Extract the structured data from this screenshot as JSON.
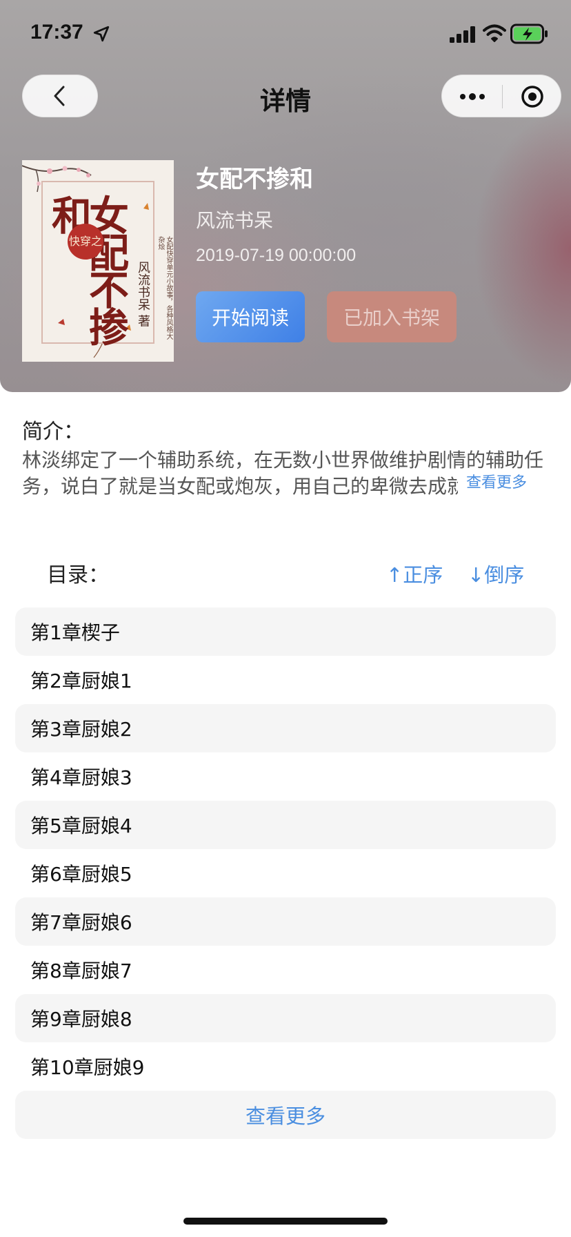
{
  "status_bar": {
    "time": "17:37"
  },
  "nav": {
    "title": "详情"
  },
  "book": {
    "title": "女配不掺和",
    "author": "风流书呆",
    "date": "2019-07-19 00:00:00",
    "cover": {
      "title": "女配不掺和",
      "seal": "快穿之",
      "author": "风流书呆 著",
      "blurb": "女配快穿单元小故事，各种风格大杂烩"
    }
  },
  "actions": {
    "read_label": "开始阅读",
    "shelf_label": "已加入书架"
  },
  "intro": {
    "label": "简介：",
    "text": "林淡绑定了一个辅助系统，在无数小世界做维护剧情的辅助任务，说白了就是当女配或炮灰，用自己的卑微去成就",
    "more_label": "查看更多"
  },
  "toc": {
    "label": "目录：",
    "sort_asc_label": "↑正序",
    "sort_desc_label": "↓倒序",
    "chapters": [
      "第1章楔子",
      "第2章厨娘1",
      "第3章厨娘2",
      "第4章厨娘3",
      "第5章厨娘4",
      "第6章厨娘5",
      "第7章厨娘6",
      "第8章厨娘7",
      "第9章厨娘8",
      "第10章厨娘9"
    ],
    "more_label": "查看更多"
  },
  "colors": {
    "accent_blue": "#4a8ee0",
    "read_button": "#3f80e6",
    "shelf_button": "#c7897d",
    "row_shade": "#f5f5f5"
  }
}
